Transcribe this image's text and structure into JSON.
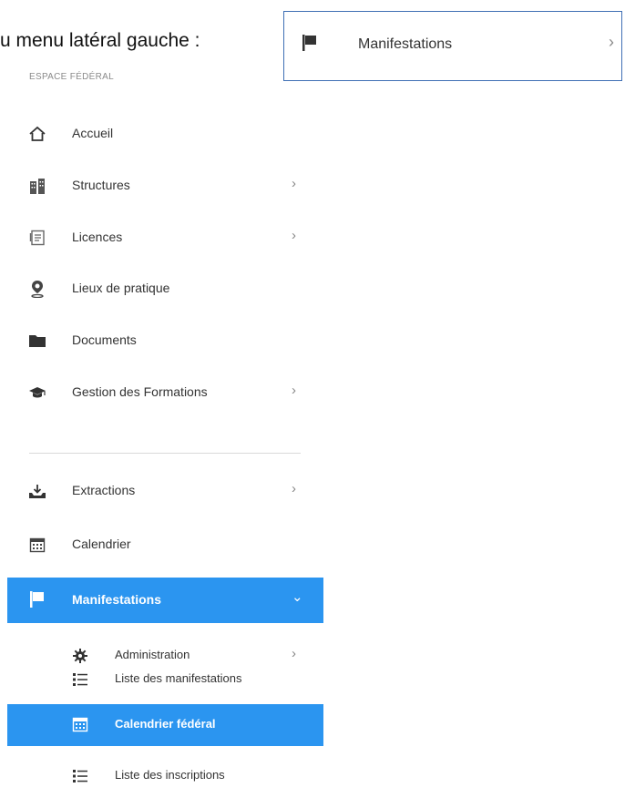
{
  "intro_text": "u menu latéral gauche :",
  "callout": {
    "label": "Manifestations",
    "chevron": "›",
    "icon": "flag-icon"
  },
  "sidebar": {
    "section_header": "ESPACE FÉDÉRAL",
    "items": [
      {
        "label": "Accueil",
        "icon": "home-icon",
        "has_children": false
      },
      {
        "label": "Structures",
        "icon": "buildings-icon",
        "has_children": true,
        "chevron": "›"
      },
      {
        "label": "Licences",
        "icon": "license-card-icon",
        "has_children": true,
        "chevron": "›"
      },
      {
        "label": "Lieux de pratique",
        "icon": "location-pin-icon",
        "has_children": false
      },
      {
        "label": "Documents",
        "icon": "folder-icon",
        "has_children": false
      },
      {
        "label": "Gestion des Formations",
        "icon": "graduation-cap-icon",
        "has_children": true,
        "chevron": "›"
      },
      {
        "label": "Extractions",
        "icon": "download-tray-icon",
        "has_children": true,
        "chevron": "›"
      },
      {
        "label": "Calendrier",
        "icon": "calendar-icon",
        "has_children": false
      },
      {
        "label": "Manifestations",
        "icon": "flag-icon",
        "has_children": true,
        "chevron": "⌄",
        "active": true
      }
    ],
    "subitems": [
      {
        "label": "Administration",
        "icon": "gear-icon",
        "chevron": "›"
      },
      {
        "label": "Liste des manifestations",
        "icon": "list-icon"
      },
      {
        "label": "Calendrier fédéral",
        "icon": "calendar-icon",
        "active": true
      },
      {
        "label": "Liste des inscriptions",
        "icon": "list-icon"
      }
    ]
  },
  "colors": {
    "active_bg": "#2b95f0",
    "callout_border": "#3f6fb4"
  }
}
